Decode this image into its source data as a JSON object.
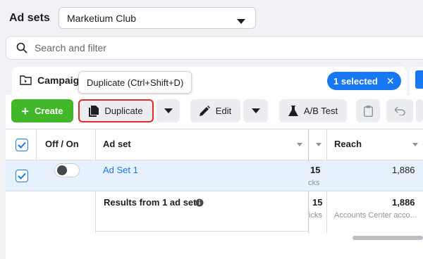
{
  "header": {
    "title": "Ad sets",
    "account": "Marketium Club"
  },
  "search": {
    "placeholder": "Search and filter"
  },
  "tabs": {
    "campaigns": "Campaig"
  },
  "tooltip": {
    "text": "Duplicate (Ctrl+Shift+D)"
  },
  "selection": {
    "label": "1 selected",
    "clear": "✕"
  },
  "toolbar": {
    "create": "Create",
    "duplicate": "Duplicate",
    "edit": "Edit",
    "ab_test": "A/B Test"
  },
  "table": {
    "columns": {
      "toggle": "Off / On",
      "name": "Ad set",
      "reach": "Reach"
    },
    "rows": [
      {
        "name": "Ad Set 1",
        "partial_value": "15",
        "partial_sub": "cks",
        "reach": "1,886",
        "checked": true,
        "on": false
      }
    ],
    "summary": {
      "label": "Results from 1 ad set",
      "partial_value": "15",
      "partial_sub": "icks",
      "reach": "1,886",
      "reach_sub": "Accounts Center acco..."
    }
  },
  "colors": {
    "primary": "#1877f2",
    "create": "#42b72a",
    "highlight": "#e02d24"
  }
}
